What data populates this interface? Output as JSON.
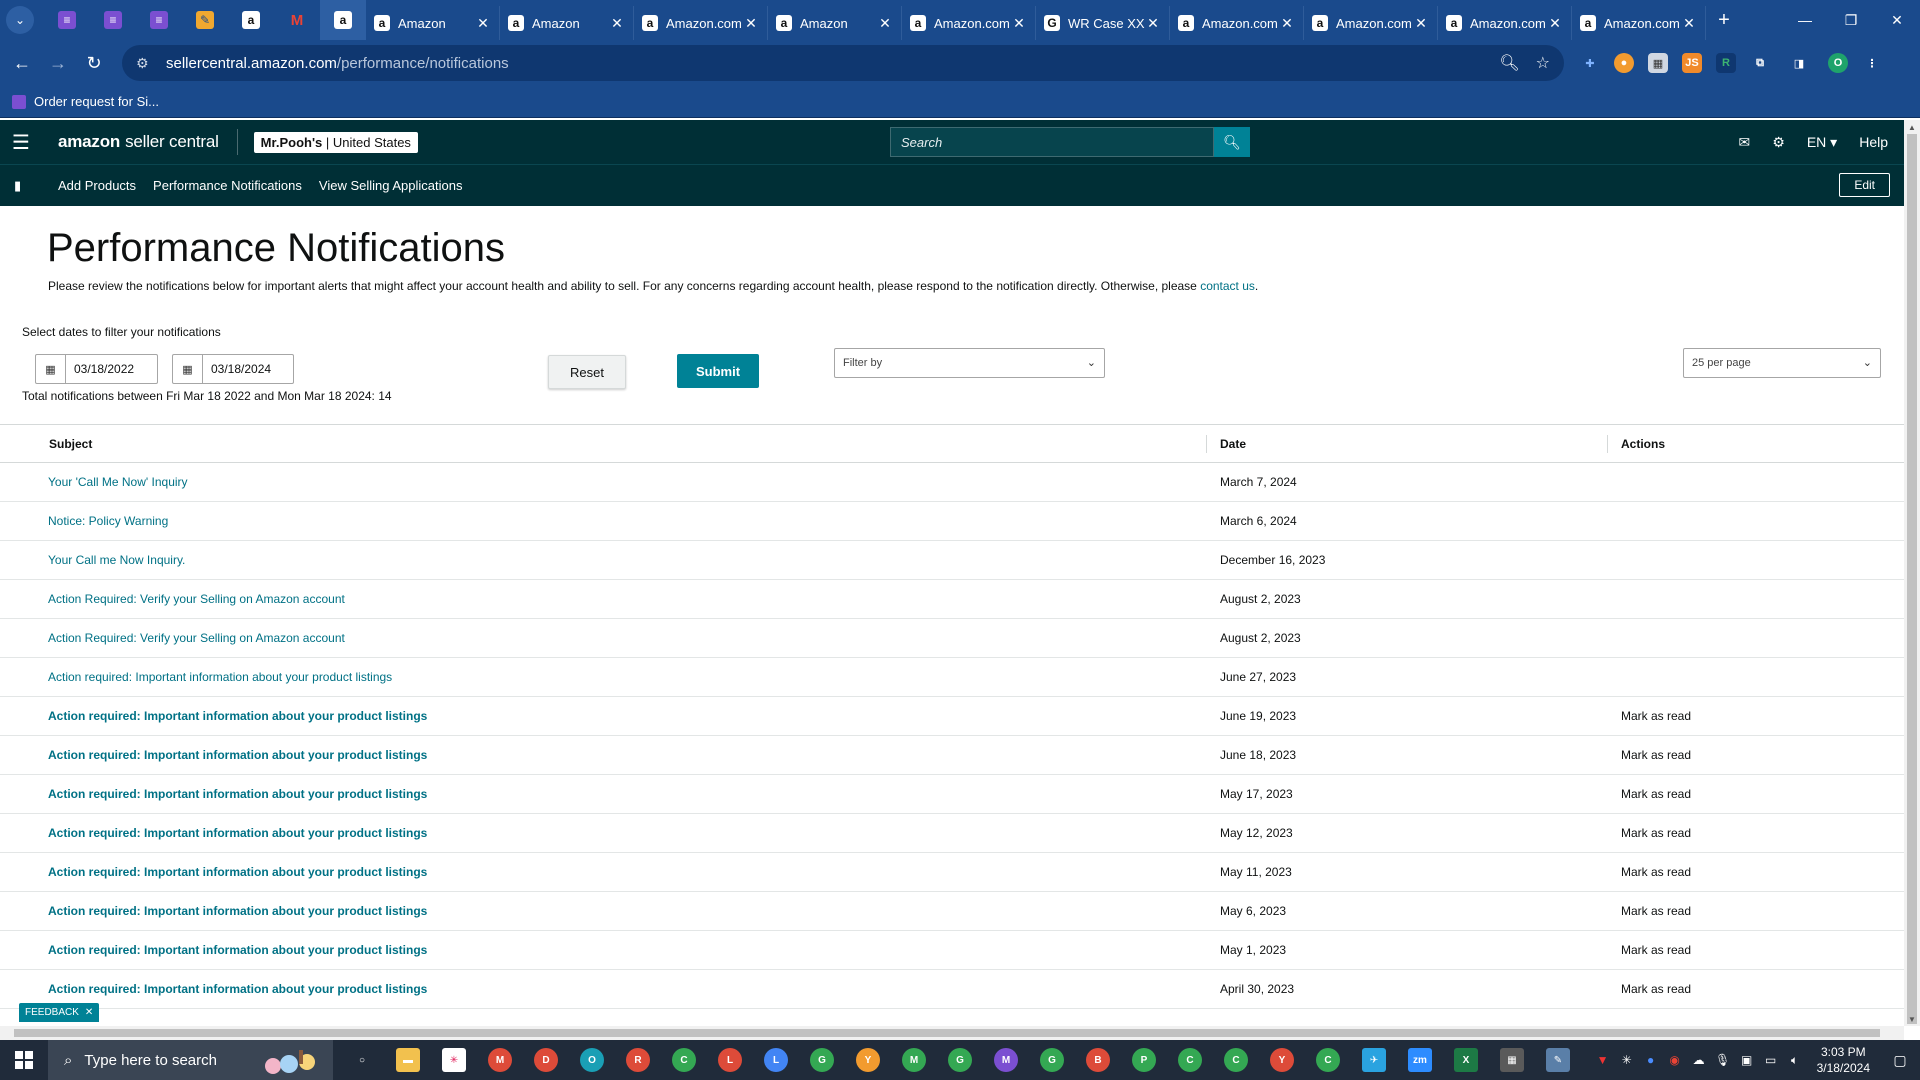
{
  "browser": {
    "tabs": [
      {
        "label": "Amazon"
      },
      {
        "label": "Amazon"
      },
      {
        "label": "Amazon.com"
      },
      {
        "label": "Amazon"
      },
      {
        "label": "Amazon.com"
      },
      {
        "label": "WR Case XX"
      },
      {
        "label": "Amazon.com"
      },
      {
        "label": "Amazon.com"
      },
      {
        "label": "Amazon.com"
      },
      {
        "label": "Amazon.com"
      }
    ],
    "url_host": "sellercentral.amazon.com",
    "url_path": "/performance/notifications",
    "bookmark": "Order request for Si...",
    "profile_initial": "O"
  },
  "header": {
    "logo_bold": "amazon",
    "logo_rest": "seller central",
    "account_name": "Mr.Pooh's",
    "account_region": " | United States",
    "search_placeholder": "Search",
    "language": "EN",
    "help": "Help"
  },
  "nav": {
    "items": [
      "Add Products",
      "Performance Notifications",
      "View Selling Applications"
    ],
    "edit": "Edit"
  },
  "page": {
    "title": "Performance Notifications",
    "intro": "Please review the notifications below for important alerts that might affect your account health and ability to sell. For any concerns regarding account health, please respond to the notification directly. Otherwise, please ",
    "intro_link": "contact us",
    "intro_end": ".",
    "filter_label": "Select dates to filter your notifications",
    "start_date": "03/18/2022",
    "end_date": "03/18/2024",
    "total_text": "Total notifications between Fri Mar 18 2022 and Mon Mar 18 2024: 14",
    "reset": "Reset",
    "submit": "Submit",
    "filter_by": "Filter by",
    "per_page": "25 per page",
    "feedback": "FEEDBACK"
  },
  "table": {
    "headers": {
      "subject": "Subject",
      "date": "Date",
      "actions": "Actions"
    },
    "rows": [
      {
        "subject": "Your 'Call Me Now' Inquiry",
        "date": "March 7, 2024",
        "action": "",
        "unread": false
      },
      {
        "subject": "Notice: Policy Warning",
        "date": "March 6, 2024",
        "action": "",
        "unread": false
      },
      {
        "subject": "Your Call me Now Inquiry.",
        "date": "December 16, 2023",
        "action": "",
        "unread": false
      },
      {
        "subject": "Action Required: Verify your Selling on Amazon account",
        "date": "August 2, 2023",
        "action": "",
        "unread": false
      },
      {
        "subject": "Action Required: Verify your Selling on Amazon account",
        "date": "August 2, 2023",
        "action": "",
        "unread": false
      },
      {
        "subject": "Action required: Important information about your product listings",
        "date": "June 27, 2023",
        "action": "",
        "unread": false
      },
      {
        "subject": "Action required: Important information about your product listings",
        "date": "June 19, 2023",
        "action": "Mark as read",
        "unread": true
      },
      {
        "subject": "Action required: Important information about your product listings",
        "date": "June 18, 2023",
        "action": "Mark as read",
        "unread": true
      },
      {
        "subject": "Action required: Important information about your product listings",
        "date": "May 17, 2023",
        "action": "Mark as read",
        "unread": true
      },
      {
        "subject": "Action required: Important information about your product listings",
        "date": "May 12, 2023",
        "action": "Mark as read",
        "unread": true
      },
      {
        "subject": "Action required: Important information about your product listings",
        "date": "May 11, 2023",
        "action": "Mark as read",
        "unread": true
      },
      {
        "subject": "Action required: Important information about your product listings",
        "date": "May 6, 2023",
        "action": "Mark as read",
        "unread": true
      },
      {
        "subject": "Action required: Important information about your product listings",
        "date": "May 1, 2023",
        "action": "Mark as read",
        "unread": true
      },
      {
        "subject": "Action required: Important information about your product listings",
        "date": "April 30, 2023",
        "action": "Mark as read",
        "unread": true
      }
    ]
  },
  "taskbar": {
    "search_placeholder": "Type here to search",
    "time": "3:03 PM",
    "date": "3/18/2024"
  },
  "colors": {
    "header_bg": "#002f36",
    "accent_teal": "#008296",
    "link": "#007185",
    "browser_blue": "#1a4a8c"
  }
}
